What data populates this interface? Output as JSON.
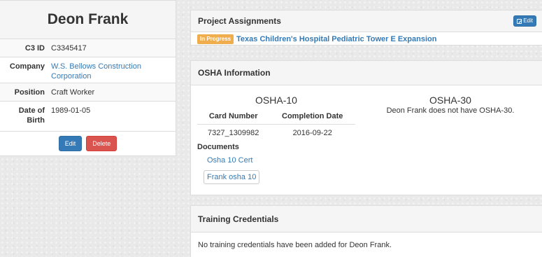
{
  "profile": {
    "name": "Deon Frank",
    "fields": {
      "c3id": {
        "label": "C3 ID",
        "value": "C3345417"
      },
      "company": {
        "label": "Company",
        "value": "W.S. Bellows Construction Corporation"
      },
      "position": {
        "label": "Position",
        "value": "Craft Worker"
      },
      "dob": {
        "label": "Date of Birth",
        "value": "1989-01-05"
      }
    },
    "edit_label": "Edit",
    "delete_label": "Delete"
  },
  "projects": {
    "title": "Project Assignments",
    "edit_label": "Edit",
    "status": "In Progress",
    "project_name": "Texas Children's Hospital Pediatric Tower E Expansion"
  },
  "osha": {
    "title": "OSHA Information",
    "osha10": {
      "title": "OSHA-10",
      "columns": [
        "Card Number",
        "Completion Date"
      ],
      "rows": [
        [
          "7327_1309982",
          "2016-09-22"
        ]
      ],
      "documents_label": "Documents",
      "documents": [
        "Osha 10 Cert",
        "Frank osha 10"
      ]
    },
    "osha30": {
      "title": "OSHA-30",
      "message": "Deon Frank does not have OSHA-30."
    }
  },
  "training": {
    "title": "Training Credentials",
    "message": "No training credentials have been added for Deon Frank."
  },
  "colors": {
    "primary": "#337ab7",
    "danger": "#d9534f",
    "warning": "#f0ad4e"
  }
}
